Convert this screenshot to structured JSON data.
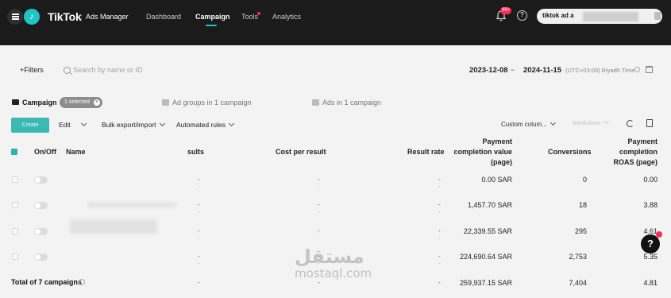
{
  "topbar": {
    "brand": "TikTok",
    "brand_sub": "Ads Manager",
    "nav": [
      "Dashboard",
      "Campaign",
      "Tools",
      "Analytics"
    ],
    "notifications": "99+",
    "account_name": "tiktok ad a",
    "accent_color": "#20c4c4"
  },
  "filterbar": {
    "filters_label": "+Filters",
    "search_placeholder": "Search by name or ID",
    "date_start": "2023-12-08",
    "date_sep": "~",
    "date_end": "2024-11-15",
    "timezone": "(UTC+03:00) Riyadh Time"
  },
  "tabs": {
    "campaign": "Campaign",
    "selected": "1 selected",
    "ad_groups": "Ad groups in 1 campaign",
    "ads": "Ads in 1 campaign"
  },
  "toolbar": {
    "create": "Create",
    "edit": "Edit",
    "bulk": "Bulk export/import",
    "rules": "Automated rules",
    "custom_columns": "Custom colum...",
    "breakdown": "Breakdown"
  },
  "table": {
    "headers": {
      "onoff": "On/Off",
      "name": "Name",
      "results": "sults",
      "cost": "Cost per result",
      "rate": "Result rate",
      "pcv": [
        "Payment",
        "completion value",
        "(page)"
      ],
      "conversions": "Conversions",
      "roas": [
        "Payment",
        "completion",
        "ROAS (page)"
      ]
    },
    "rows": [
      {
        "results": "-",
        "cost": "-",
        "rate": "-",
        "pcv": "0.00 SAR",
        "conversions": "0",
        "roas": "0.00"
      },
      {
        "results": "-",
        "cost": "-",
        "rate": "-",
        "pcv": "1,457.70 SAR",
        "conversions": "18",
        "roas": "3.88"
      },
      {
        "results": "-",
        "cost": "-",
        "rate": "-",
        "pcv": "22,339.55 SAR",
        "conversions": "295",
        "roas": "4.61"
      },
      {
        "results": "-",
        "cost": "-",
        "rate": "-",
        "pcv": "224,690.64 SAR",
        "conversions": "2,753",
        "roas": "5.35"
      }
    ],
    "total": {
      "label": "Total of 7 campaigns",
      "results": "-",
      "cost": "-",
      "rate": "-",
      "pcv": "259,937.15 SAR",
      "conversions": "7,404",
      "roas": "4.81"
    }
  },
  "watermark": {
    "arabic": "مستقل",
    "latin": "mostaql.com"
  }
}
